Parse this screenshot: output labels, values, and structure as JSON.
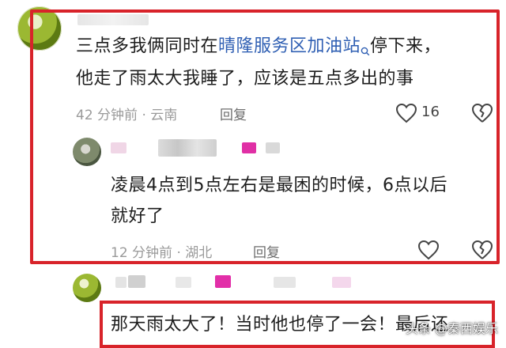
{
  "comments": [
    {
      "text_before_link": "三点多我俩同时在",
      "link_text": "晴隆服务区加油站",
      "text_after_link": "停下来，",
      "line2": "他走了雨太大我睡了，应该是五点多出的事",
      "time": "42 分钟前 · 云南",
      "reply_label": "回复",
      "like_count": "16"
    },
    {
      "line1": "凌晨4点到5点左右是最困的时候，6点以后",
      "line2": "就好了",
      "time": "12 分钟前 · 湖北",
      "reply_label": "回复"
    },
    {
      "text": "那天雨太大了！当时他也停了一会！最后还"
    }
  ],
  "watermark": "头条 @秦西娱乐",
  "colors": {
    "highlight_border": "#d8232a",
    "link": "#2f5fb3",
    "meta": "#9a9a9a"
  },
  "icons": [
    "search-icon",
    "heart-icon",
    "broken-heart-icon"
  ]
}
